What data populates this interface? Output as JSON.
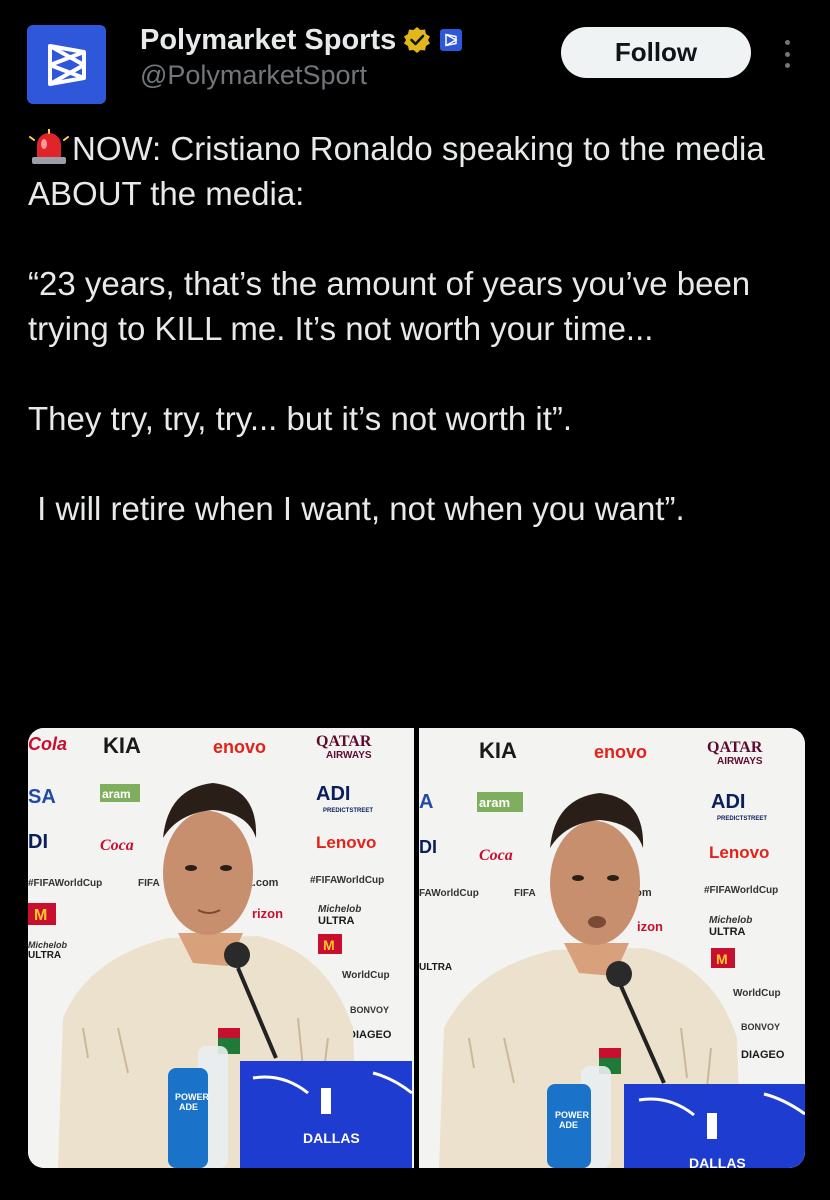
{
  "account": {
    "name": "Polymarket Sports",
    "handle": "@PolymarketSport",
    "verified": true,
    "avatar_icon": "polymarket-logo-icon",
    "brand_color": "#2f57d9"
  },
  "actions": {
    "follow_label": "Follow",
    "more_icon": "more-vertical-icon"
  },
  "tweet": {
    "emoji_icon": "siren-icon",
    "line1": "NOW: Cristiano Ronaldo speaking to the media ABOUT the media:",
    "quote1": "“23 years, that’s the amount of years you’ve been trying to KILL me. It’s not worth your time...",
    "quote2": "They try, try, try... but it’s not worth it”.",
    "quote3": " I will retire when I want, not when you want”."
  },
  "media": {
    "count": 2,
    "photos": [
      {
        "backdrop_text": [
          "Cola",
          "SA",
          "DI",
          "#FIFAWorldCup",
          "Michelob ULTRA",
          "KIA",
          "enovo",
          "aram",
          "Coca-Cola",
          "FIFA",
          "fa.com",
          "rizon",
          "QATAR",
          "AIRWAYS",
          "ADI",
          "PREDICTSTREET",
          "Lenovo",
          "#FIFAWorldCup",
          "ULTRA",
          "WorldCup",
          "BONVOY",
          "DIAGEO"
        ],
        "bottle_text": "POWER ADE",
        "desk_sign": "DALLAS"
      },
      {
        "backdrop_text": [
          "A",
          "DI",
          "FAWorldCup",
          "ULTRA",
          "KIA",
          "enovo",
          "aram",
          "Coca-Cola",
          "FIFA",
          "com",
          "izon",
          "QATAR",
          "AIRWAYS",
          "ADI",
          "PREDICTSTREET",
          "Lenovo",
          "#FIFAWorldCup",
          "ULTRA",
          "WorldCup",
          "BONVOY",
          "DIAGEO"
        ],
        "bottle_text": "POWER ADE",
        "desk_sign": "DALLAS"
      }
    ]
  }
}
